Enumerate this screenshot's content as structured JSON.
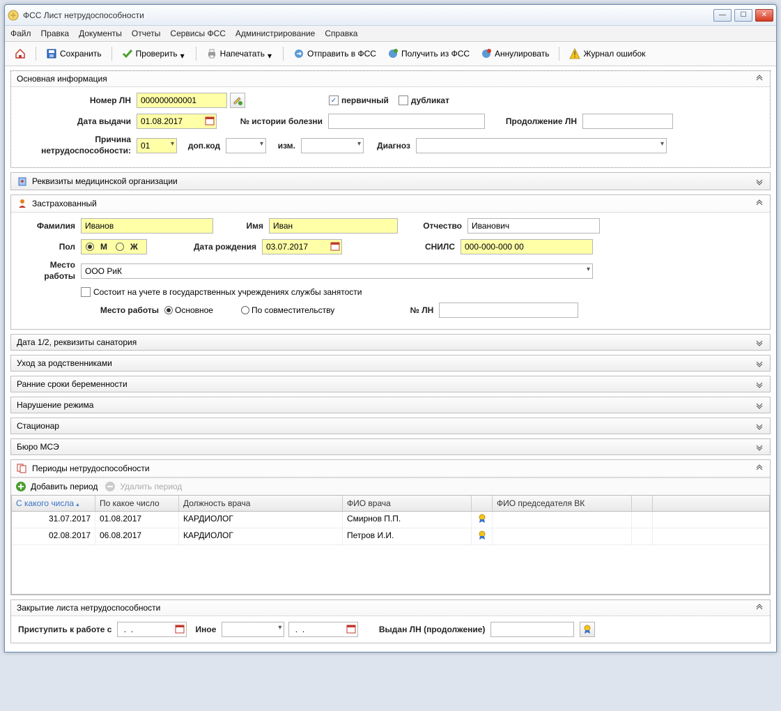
{
  "titlebar": {
    "title": "ФСС Лист нетрудоспособности"
  },
  "menubar": [
    "Файл",
    "Правка",
    "Документы",
    "Отчеты",
    "Сервисы ФСС",
    "Администрирование",
    "Справка"
  ],
  "toolbar": {
    "home": "",
    "save": "Сохранить",
    "check": "Проверить",
    "print": "Напечатать",
    "send": "Отправить в ФСС",
    "receive": "Получить из ФСС",
    "annul": "Аннулировать",
    "errors": "Журнал ошибок"
  },
  "sections": {
    "main": "Основная информация",
    "med_org": "Реквизиты медицинской организации",
    "insured": "Застрахованный",
    "sanatorium": "Дата 1/2, реквизиты санатория",
    "relatives": "Уход за родственниками",
    "pregnancy": "Ранние сроки беременности",
    "violation": "Нарушение режима",
    "stationary": "Стационар",
    "mse": "Бюро МСЭ",
    "periods": "Периоды нетрудоспособности",
    "closing": "Закрытие листа нетрудоспособности"
  },
  "main": {
    "num_label": "Номер ЛН",
    "num_value": "000000000001",
    "primary_label": "первичный",
    "duplicate_label": "дубликат",
    "date_label": "Дата выдачи",
    "date_value": "01.08.2017",
    "history_label": "№ истории болезни",
    "continuation_label": "Продолжение ЛН",
    "reason_label": "Причина нетрудоспособности:",
    "reason_value": "01",
    "addcode_label": "доп.код",
    "change_label": "изм.",
    "diagnosis_label": "Диагноз"
  },
  "insured": {
    "surname_label": "Фамилия",
    "surname_value": "Иванов",
    "name_label": "Имя",
    "name_value": "Иван",
    "patronym_label": "Отчество",
    "patronym_value": "Иванович",
    "gender_label": "Пол",
    "gender_m": "М",
    "gender_f": "Ж",
    "birthdate_label": "Дата рождения",
    "birthdate_value": "03.07.2017",
    "snils_label": "СНИЛС",
    "snils_value": "000-000-000 00",
    "workplace_label": "Место работы",
    "workplace_value": "ООО РиК",
    "unemployed_label": "Состоит на учете в государственных учреждениях службы занятости",
    "workplace_type_label": "Место работы",
    "workplace_main": "Основное",
    "workplace_secondary": "По совместительству",
    "ln_num_label": "№ ЛН"
  },
  "periods": {
    "add": "Добавить период",
    "remove": "Удалить период",
    "columns": [
      "С какого числа",
      "По какое число",
      "Должность врача",
      "ФИО врача",
      "",
      "ФИО председателя ВК",
      "",
      ""
    ],
    "rows": [
      {
        "from": "31.07.2017",
        "to": "01.08.2017",
        "post": "КАРДИОЛОГ",
        "doctor": "Смирнов П.П.",
        "chair": ""
      },
      {
        "from": "02.08.2017",
        "to": "06.08.2017",
        "post": "КАРДИОЛОГ",
        "doctor": "Петров И.И.",
        "chair": ""
      }
    ]
  },
  "closing": {
    "return_label": "Приступить к работе с",
    "other_label": "Иное",
    "issued_label": "Выдан ЛН (продолжение)",
    "date_placeholder": " .  . "
  }
}
